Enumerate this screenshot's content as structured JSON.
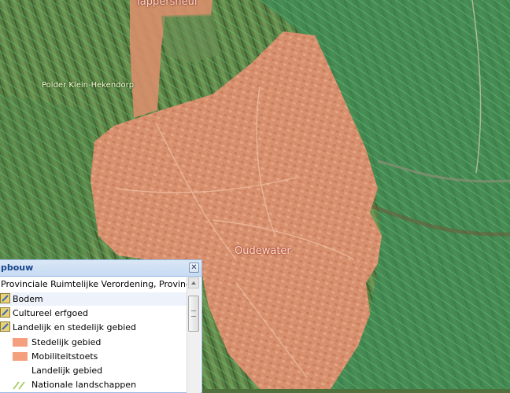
{
  "map": {
    "place_labels": {
      "tappersheul": "Tappersheul",
      "polder": "Polder Klein-Hekendorp",
      "oudewater": "Oudewater"
    },
    "colors": {
      "urban_fill": "#d9906f",
      "rural_green": "#4d8a49",
      "landscape_hatch": "#5fc97a"
    }
  },
  "panel": {
    "title": "pbouw",
    "close_icon": "close-icon",
    "rows": [
      {
        "label": "Provinciale Ruimtelijke Verordening, Provincie Utr"
      },
      {
        "label": "Bodem",
        "icon": "folder-layer-icon"
      },
      {
        "label": "Cultureel erfgoed",
        "icon": "folder-layer-icon"
      },
      {
        "label": "Landelijk en stedelijk gebied",
        "icon": "folder-layer-icon"
      },
      {
        "label": "Stedelijk gebied",
        "icon": "swatch-orange",
        "color": "#f4a07f"
      },
      {
        "label": "Mobiliteitstoets",
        "icon": "swatch-orange",
        "color": "#f4a07f"
      },
      {
        "label": "Landelijk gebied",
        "icon": "swatch-none"
      },
      {
        "label": "Nationale landschappen",
        "icon": "hatch-green-icon",
        "color": "#9ac84a"
      }
    ]
  }
}
